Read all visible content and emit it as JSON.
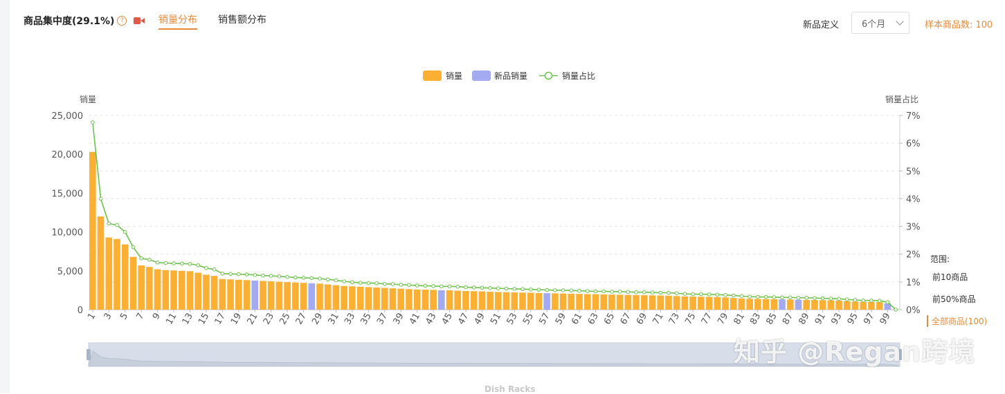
{
  "header": {
    "title": "商品集中度(29.1%)",
    "help": "?"
  },
  "tabs": [
    {
      "label": "销量分布",
      "active": true
    },
    {
      "label": "销售额分布",
      "active": false
    }
  ],
  "controls": {
    "definition_label": "新品定义",
    "definition_value": "6个月",
    "sample_label": "样本商品数: 100"
  },
  "range": {
    "title": "范围:",
    "items": [
      {
        "label": "前10商品",
        "active": false
      },
      {
        "label": "前50%商品",
        "active": false
      },
      {
        "label": "全部商品(100)",
        "active": true
      }
    ]
  },
  "watermark": "知乎 @Regan跨境",
  "footer": "Dish Racks",
  "chart_data": {
    "type": "bar",
    "ylabel": "销量",
    "y2label": "销量占比",
    "ylim": [
      0,
      25000
    ],
    "y2lim": [
      0,
      7
    ],
    "yticks": [
      "0",
      "5,000",
      "10,000",
      "15,000",
      "20,000",
      "25,000"
    ],
    "y2ticks": [
      "0%",
      "1%",
      "2%",
      "3%",
      "4%",
      "5%",
      "6%",
      "7%"
    ],
    "xticks": [
      "1",
      "3",
      "5",
      "7",
      "9",
      "11",
      "13",
      "15",
      "17",
      "19",
      "21",
      "23",
      "25",
      "27",
      "29",
      "31",
      "33",
      "35",
      "37",
      "39",
      "41",
      "43",
      "45",
      "47",
      "49",
      "51",
      "53",
      "55",
      "57",
      "59",
      "61",
      "63",
      "65",
      "67",
      "69",
      "71",
      "73",
      "75",
      "77",
      "79",
      "81",
      "83",
      "85",
      "87",
      "89",
      "91",
      "93",
      "95",
      "97",
      "99"
    ],
    "legend": [
      "销量",
      "新品销量",
      "销量占比"
    ],
    "colors": {
      "sales": "#fbb034",
      "new": "#a4aaf0",
      "ratio": "#6cc24a",
      "grid": "#e4e4e4"
    },
    "sales": [
      20300,
      12000,
      9300,
      9100,
      8400,
      6800,
      5700,
      5500,
      5200,
      5100,
      5050,
      5000,
      4950,
      4750,
      4500,
      4350,
      3950,
      3900,
      3850,
      3800,
      3750,
      3700,
      3650,
      3600,
      3550,
      3500,
      3450,
      3400,
      3350,
      3250,
      3150,
      3050,
      3000,
      2950,
      2900,
      2850,
      2800,
      2750,
      2700,
      2650,
      2600,
      2580,
      2550,
      2500,
      2500,
      2450,
      2400,
      2380,
      2350,
      2300,
      2280,
      2250,
      2220,
      2200,
      2180,
      2150,
      2120,
      2100,
      2080,
      2050,
      2030,
      2000,
      1980,
      1960,
      1940,
      1920,
      1900,
      1880,
      1860,
      1840,
      1820,
      1800,
      1750,
      1700,
      1680,
      1660,
      1640,
      1620,
      1580,
      1500,
      1450,
      1400,
      1380,
      1360,
      1340,
      1320,
      1300,
      1280,
      1260,
      1240,
      1220,
      1200,
      1150,
      1100,
      1050,
      1000,
      980,
      950,
      800,
      0
    ],
    "new_items": [
      21,
      28,
      44,
      57,
      86,
      88,
      99
    ],
    "ratio": [
      6.75,
      4.0,
      3.1,
      3.05,
      2.8,
      2.25,
      1.85,
      1.8,
      1.7,
      1.68,
      1.67,
      1.66,
      1.65,
      1.6,
      1.5,
      1.45,
      1.3,
      1.29,
      1.28,
      1.27,
      1.25,
      1.23,
      1.22,
      1.2,
      1.18,
      1.16,
      1.15,
      1.14,
      1.12,
      1.09,
      1.06,
      1.02,
      0.99,
      0.97,
      0.96,
      0.95,
      0.93,
      0.92,
      0.9,
      0.89,
      0.87,
      0.86,
      0.85,
      0.84,
      0.84,
      0.83,
      0.81,
      0.8,
      0.79,
      0.78,
      0.77,
      0.76,
      0.75,
      0.74,
      0.73,
      0.72,
      0.71,
      0.7,
      0.7,
      0.69,
      0.68,
      0.67,
      0.66,
      0.66,
      0.65,
      0.65,
      0.64,
      0.63,
      0.63,
      0.62,
      0.61,
      0.61,
      0.59,
      0.57,
      0.56,
      0.56,
      0.55,
      0.54,
      0.53,
      0.51,
      0.49,
      0.47,
      0.46,
      0.46,
      0.45,
      0.44,
      0.44,
      0.43,
      0.43,
      0.42,
      0.41,
      0.4,
      0.39,
      0.37,
      0.35,
      0.33,
      0.33,
      0.32,
      0.27,
      0.0
    ]
  }
}
